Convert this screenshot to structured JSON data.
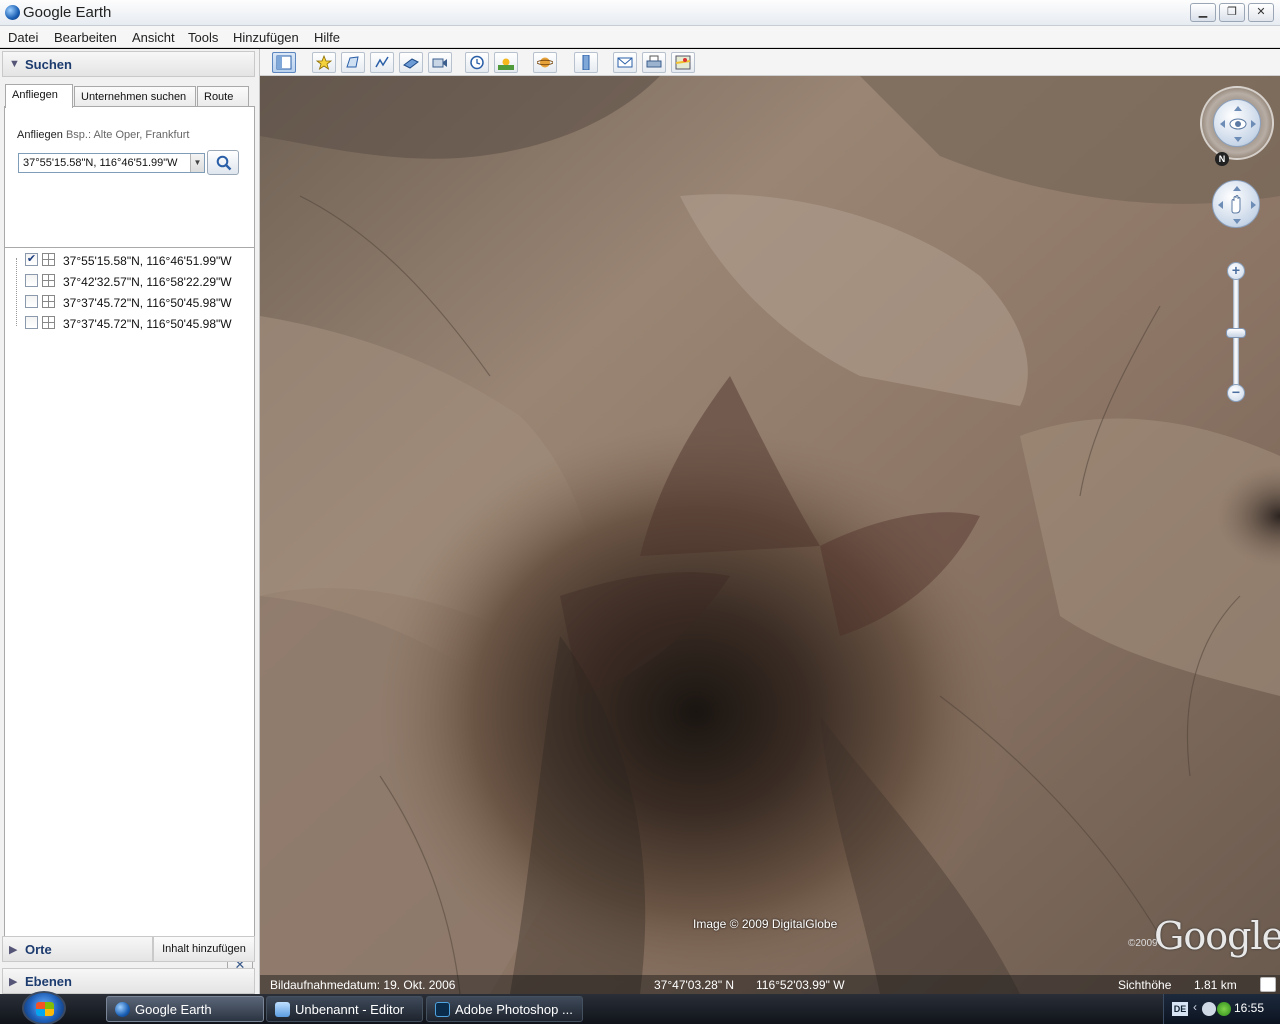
{
  "window": {
    "title": "Google Earth"
  },
  "menu": [
    "Datei",
    "Bearbeiten",
    "Ansicht",
    "Tools",
    "Hinzufügen",
    "Hilfe"
  ],
  "search_panel": {
    "header": "Suchen",
    "tabs": [
      "Anfliegen",
      "Unternehmen suchen",
      "Route"
    ],
    "fly_label": "Anfliegen",
    "fly_hint": "Bsp.: Alte Oper, Frankfurt",
    "fly_value": "37°55'15.58\"N, 116°46'51.99\"W",
    "results": [
      {
        "text": "37°55'15.58\"N, 116°46'51.99\"W",
        "checked": true
      },
      {
        "text": "37°42'32.57\"N, 116°58'22.29\"W",
        "checked": false
      },
      {
        "text": "37°37'45.72\"N, 116°50'45.98\"W",
        "checked": false
      },
      {
        "text": "37°37'45.72\"N, 116°50'45.98\"W",
        "checked": false
      }
    ],
    "clear_label": "✕"
  },
  "places_panel": {
    "header": "Orte",
    "add_content": "Inhalt hinzufügen"
  },
  "layers_panel": {
    "header": "Ebenen"
  },
  "toolbar": [
    "sidebar-toggle-icon",
    "placemark-icon",
    "polygon-icon",
    "path-icon",
    "image-overlay-icon",
    "record-tour-icon",
    "historical-imagery-icon",
    "sunlight-icon",
    "planets-icon",
    "ruler-icon",
    "email-icon",
    "print-icon",
    "google-maps-icon"
  ],
  "map": {
    "image_credit": "Image © 2009 DigitalGlobe",
    "logo": "Google",
    "logo_year": "©2009",
    "north_label": "N",
    "zoom_in": "+",
    "zoom_out": "−"
  },
  "status": {
    "imagery_date": "Bildaufnahmedatum: 19. Okt. 2006",
    "lat": "37°47'03.28\" N",
    "lon": "116°52'03.99\" W",
    "eye_alt_label": "Sichthöhe",
    "eye_alt_value": "1.81 km"
  },
  "taskbar": {
    "tasks": [
      "Google Earth",
      "Unbenannt - Editor",
      "Adobe Photoshop ..."
    ],
    "lang": "DE",
    "time": "16:55"
  }
}
